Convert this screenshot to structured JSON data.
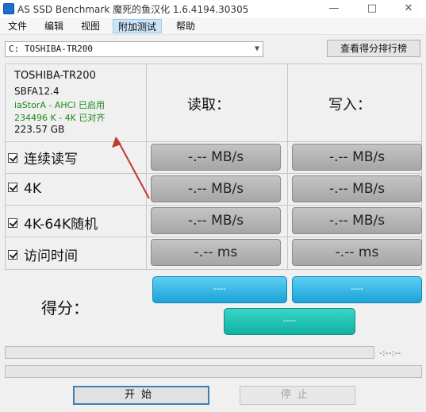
{
  "window": {
    "title": "AS SSD Benchmark 魔死的鱼汉化 1.6.4194.30305"
  },
  "window_controls": {
    "minimize": "—",
    "maximize": "□",
    "close": "✕"
  },
  "menu": [
    {
      "label": "文件"
    },
    {
      "label": "编辑"
    },
    {
      "label": "视图"
    },
    {
      "label": "附加测试",
      "active": true
    },
    {
      "label": "帮助"
    }
  ],
  "drive_select": {
    "value": "C: TOSHIBA-TR200"
  },
  "rank_button": {
    "label": "查看得分排行榜"
  },
  "drive_info": {
    "model": "TOSHIBA-TR200",
    "firmware": "SBFA12.4",
    "driver": "iaStorA - AHCI 已启用",
    "alignment": "234496 K - 4K 已对齐",
    "capacity": "223.57 GB"
  },
  "columns": {
    "read": "读取：",
    "write": "写入："
  },
  "rows": [
    {
      "label": "连续读写",
      "read": "-.-- MB/s",
      "write": "-.-- MB/s",
      "checked": true
    },
    {
      "label": "4K",
      "read": "-.-- MB/s",
      "write": "-.-- MB/s",
      "checked": true
    },
    {
      "label": "4K-64K随机",
      "read": "-.-- MB/s",
      "write": "-.-- MB/s",
      "checked": true
    },
    {
      "label": "访问时间",
      "read": "-.-- ms",
      "write": "-.-- ms",
      "checked": true
    }
  ],
  "score": {
    "label": "得分：",
    "read": "----",
    "write": "----",
    "total": "----"
  },
  "progress": {
    "time": "-:--:--"
  },
  "buttons": {
    "start": "开始",
    "stop": "停止"
  },
  "colors": {
    "score_blue": "#1aa3d8",
    "score_total": "#13b0a4",
    "annotation_arrow": "#c0392b",
    "info_green": "#1a8a1a"
  }
}
